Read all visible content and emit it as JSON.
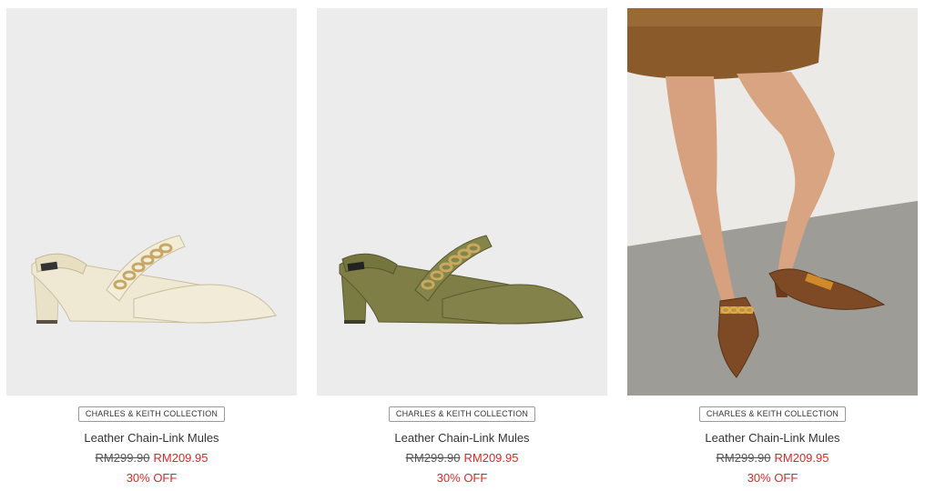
{
  "products": [
    {
      "badge": "CHARLES & KEITH COLLECTION",
      "name": "Leather Chain-Link Mules",
      "old_price": "RM299.90",
      "new_price": "RM209.95",
      "discount": "30% OFF",
      "color": "#efe8d2"
    },
    {
      "badge": "CHARLES & KEITH COLLECTION",
      "name": "Leather Chain-Link Mules",
      "old_price": "RM299.90",
      "new_price": "RM209.95",
      "discount": "30% OFF",
      "color": "#7a7a43"
    },
    {
      "badge": "CHARLES & KEITH COLLECTION",
      "name": "Leather Chain-Link Mules",
      "old_price": "RM299.90",
      "new_price": "RM209.95",
      "discount": "30% OFF",
      "color": "#7e4a26"
    }
  ]
}
